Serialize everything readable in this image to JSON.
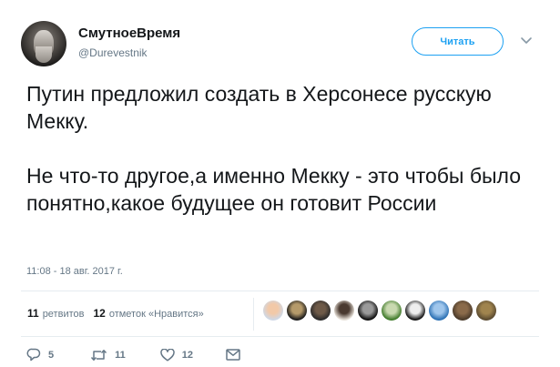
{
  "author": {
    "display_name": "СмутноеВремя",
    "handle": "@Durevestnik"
  },
  "follow_button": {
    "label": "Читать"
  },
  "tweet": {
    "paragraphs": [
      "Путин предложил создать в Херсонесе русскую Мекку.",
      "Не что-то другое,а именно Мекку - это чтобы было понятно,какое будущее он готовит России"
    ],
    "timestamp": "11:08 - 18 авг. 2017 г."
  },
  "stats": {
    "retweets_count": "11",
    "retweets_label": "ретвитов",
    "likes_count": "12",
    "likes_label": "отметок «Нравится»"
  },
  "liker_avatars": [
    {
      "icon": "liker-avatar-1",
      "colors": [
        "#cfd8e6",
        "#f2c9a8"
      ]
    },
    {
      "icon": "liker-avatar-2",
      "colors": [
        "#1a1a1a",
        "#b59a6a"
      ]
    },
    {
      "icon": "liker-avatar-3",
      "colors": [
        "#2a2a2a",
        "#6e5a48"
      ]
    },
    {
      "icon": "liker-avatar-4",
      "colors": [
        "#e8e2da",
        "#4a3a30"
      ]
    },
    {
      "icon": "liker-avatar-5",
      "colors": [
        "#0d0d0d",
        "#9a9a9a"
      ]
    },
    {
      "icon": "liker-avatar-6",
      "colors": [
        "#3f7a2a",
        "#c9d9b0"
      ]
    },
    {
      "icon": "liker-avatar-7",
      "colors": [
        "#111111",
        "#eeeeee"
      ]
    },
    {
      "icon": "liker-avatar-8",
      "colors": [
        "#2a6fb3",
        "#9fc6ec"
      ]
    },
    {
      "icon": "liker-avatar-9",
      "colors": [
        "#4a3a2a",
        "#8a6a4a"
      ]
    },
    {
      "icon": "liker-avatar-10",
      "colors": [
        "#5a4a30",
        "#a0844e"
      ]
    }
  ],
  "actions": {
    "reply_count": "5",
    "retweet_count": "11",
    "like_count": "12",
    "reply_icon": "reply-icon",
    "retweet_icon": "retweet-icon",
    "like_icon": "heart-icon",
    "dm_icon": "envelope-icon"
  },
  "colors": {
    "accent": "#1da1f2",
    "secondary_text": "#657786",
    "primary_text": "#14171a",
    "divider": "#e6ecf0"
  }
}
